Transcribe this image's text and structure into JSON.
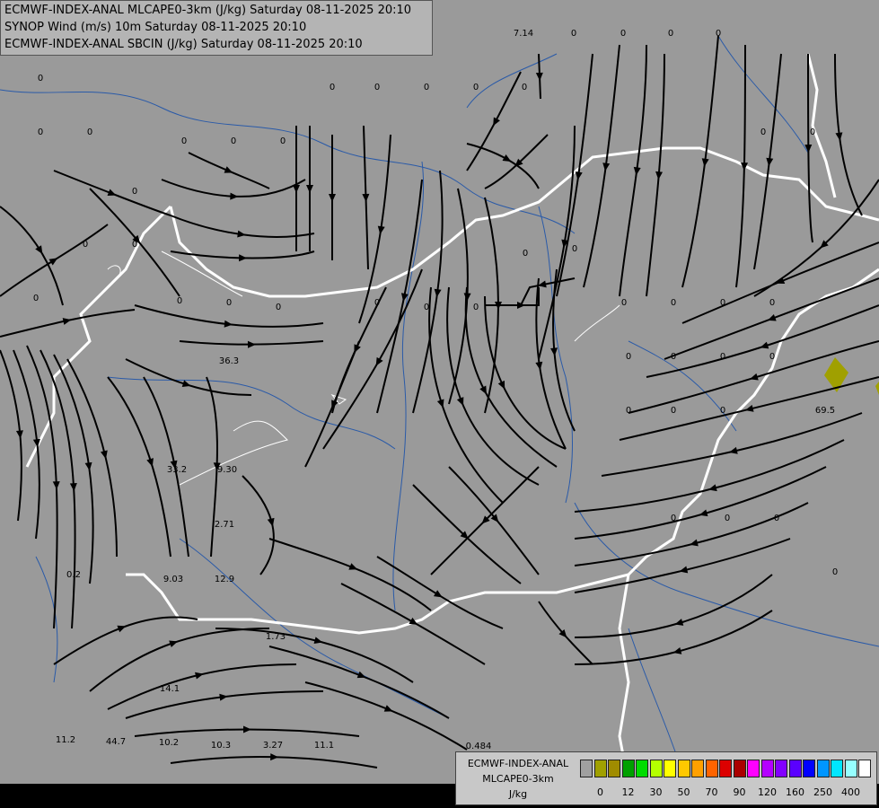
{
  "header": {
    "line1": "ECMWF-INDEX-ANAL MLCAPE0-3km (J/kg) Saturday 08-11-2025 20:10",
    "line2": "SYNOP Wind (m/s) 10m Saturday 08-11-2025 20:10",
    "line3": "ECMWF-INDEX-ANAL SBCIN (J/kg) Saturday 08-11-2025 20:10"
  },
  "legend": {
    "title1": "ECMWF-INDEX-ANAL",
    "title2": "MLCAPE0-3km",
    "unit": "J/kg",
    "colors": [
      "#a0a0a0",
      "#a0a000",
      "#a08c00",
      "#00a000",
      "#00dc00",
      "#b4ff00",
      "#ffff00",
      "#ffc800",
      "#ffa000",
      "#ff6400",
      "#dc0000",
      "#aa0000",
      "#ff00ff",
      "#b400ff",
      "#8200ff",
      "#5a00ff",
      "#0000ff",
      "#0096ff",
      "#00e6ff",
      "#96ffff",
      "#ffffff"
    ],
    "ticks": [
      "0",
      "12",
      "30",
      "50",
      "70",
      "90",
      "120",
      "160",
      "250",
      "400"
    ]
  },
  "map": {
    "background": "#9a9a9a",
    "border_color": "#ffffff",
    "river_color": "#2a5aa8",
    "streamline_color": "#000000",
    "cape_patch_color": "#a0a000",
    "values": [
      "7.14",
      "36.3",
      "33.2",
      "9.30",
      "2.71",
      "0.2",
      "9.03",
      "12.9",
      "1.73",
      "14.1",
      "10.2",
      "10.3",
      "3.27",
      "11.1",
      "11.2",
      "44.7",
      "69.5",
      "0.484",
      "0",
      "0",
      "0",
      "0",
      "0",
      "0",
      "0",
      "0",
      "0",
      "0",
      "0",
      "0",
      "0",
      "0",
      "0",
      "0",
      "0",
      "0",
      "0",
      "0",
      "0",
      "0",
      "0",
      "0",
      "0",
      "0",
      "0",
      "0",
      "0",
      "0",
      "0",
      "0",
      "0",
      "0",
      "0",
      "0",
      "0",
      "0",
      "0",
      "0",
      "0",
      "0",
      "0",
      "0"
    ]
  }
}
